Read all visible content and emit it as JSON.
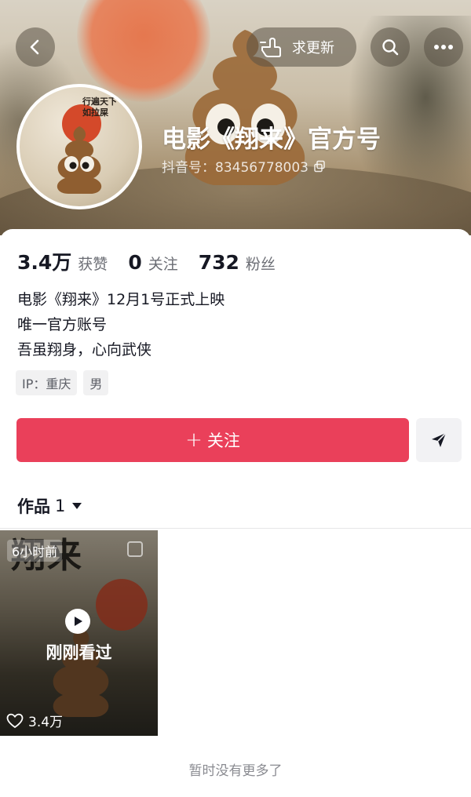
{
  "header": {
    "update_label": "求更新",
    "profile_name": "电影《翔来》官方号",
    "douyin_id": "抖音号：83456778003",
    "avatar_text": "行遍天下 不如拉屎"
  },
  "stats": [
    {
      "value": "3.4万",
      "label": "获赞"
    },
    {
      "value": "0",
      "label": "关注"
    },
    {
      "value": "732",
      "label": "粉丝"
    }
  ],
  "bio": {
    "line1": "电影《翔来》12月1号正式上映",
    "line2": "唯一官方账号",
    "line3": "吾虽翔身，心向武侠"
  },
  "tags": {
    "ip": "IP：重庆",
    "gender": "男"
  },
  "actions": {
    "follow_plus": "+",
    "follow_label": "关注"
  },
  "works": {
    "label": "作品",
    "count": "1"
  },
  "video": {
    "poster_title": "翔来",
    "time_badge": "6小时前",
    "recent_label": "刚刚看过",
    "likes": "3.4万"
  },
  "footer": {
    "no_more": "暂时没有更多了"
  },
  "colors": {
    "accent": "#ea405a",
    "text": "#161823",
    "muted": "#6b6d74"
  }
}
